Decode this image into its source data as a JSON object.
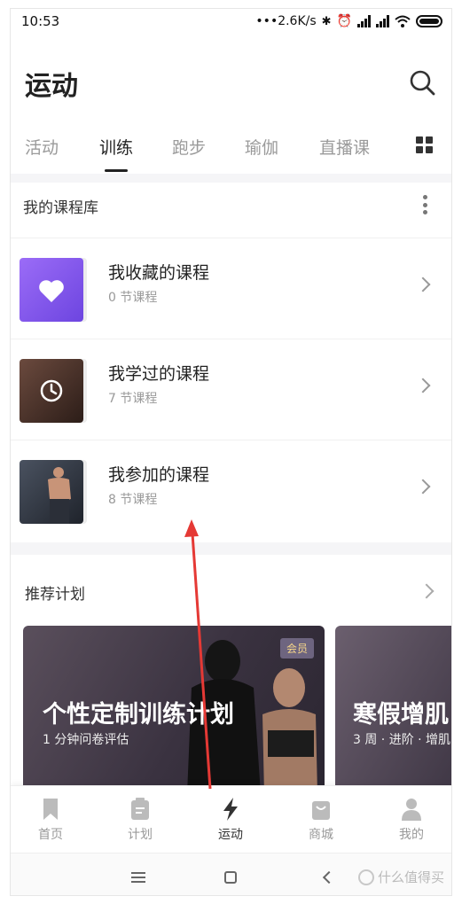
{
  "status": {
    "time": "10:53",
    "network": "•••2.6K/s"
  },
  "header": {
    "title": "运动"
  },
  "tabs": [
    {
      "label": "活动"
    },
    {
      "label": "训练"
    },
    {
      "label": "跑步"
    },
    {
      "label": "瑜伽"
    },
    {
      "label": "直播课"
    }
  ],
  "active_tab": "训练",
  "library": {
    "title": "我的课程库",
    "items": [
      {
        "title": "我收藏的课程",
        "subtitle": "0 节课程",
        "icon": "heart-icon",
        "color": "#8b5cf6"
      },
      {
        "title": "我学过的课程",
        "subtitle": "7 节课程",
        "icon": "clock-icon",
        "color": "#4a2f28"
      },
      {
        "title": "我参加的课程",
        "subtitle": "8 节课程",
        "icon": "fitness-photo",
        "color": "#3d4452"
      }
    ]
  },
  "recommended": {
    "title": "推荐计划",
    "cards": [
      {
        "title": "个性定制训练计划",
        "subtitle": "1 分钟问卷评估",
        "badge": "会员"
      },
      {
        "title": "寒假增肌",
        "subtitle": "3 周 · 进阶 · 增肌"
      }
    ]
  },
  "bottom_nav": [
    {
      "label": "首页",
      "icon": "bookmark-icon"
    },
    {
      "label": "计划",
      "icon": "clipboard-icon"
    },
    {
      "label": "运动",
      "icon": "lightning-icon"
    },
    {
      "label": "商城",
      "icon": "shop-bag-icon"
    },
    {
      "label": "我的",
      "icon": "person-icon"
    }
  ],
  "active_nav": "运动",
  "watermark": "什么值得买",
  "colors": {
    "accent": "#222222",
    "muted": "#999999",
    "annotation_arrow": "#e53935"
  }
}
